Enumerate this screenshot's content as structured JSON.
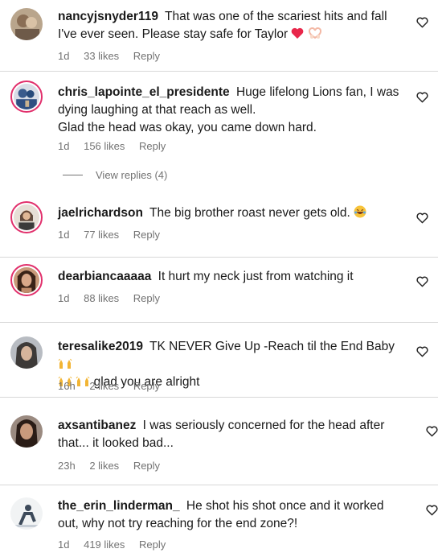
{
  "comments": [
    {
      "username": "nancyjsnyder119",
      "text": "That was one of the scariest hits and fall I've ever seen. Please stay safe for Taylor",
      "time": "1d",
      "likes": "33 likes",
      "reply": "Reply",
      "emojis": [
        "red-heart-icon",
        "heart-hands-icon"
      ]
    },
    {
      "username": "chris_lapointe_el_presidente",
      "text": "Huge lifelong Lions fan, I was dying laughing at that reach as well.",
      "text2": "Glad the head was okay, you came down hard.",
      "time": "1d",
      "likes": "156 likes",
      "reply": "Reply",
      "view_replies": "View replies (4)"
    },
    {
      "username": "jaelrichardson",
      "text": "The big brother roast never gets old.",
      "time": "1d",
      "likes": "77 likes",
      "reply": "Reply",
      "emojis": [
        "laughing-face-icon"
      ]
    },
    {
      "username": "dearbiancaaaaa",
      "text": "It hurt my neck just from watching it",
      "time": "1d",
      "likes": "88 likes",
      "reply": "Reply"
    },
    {
      "username": "teresalike2019",
      "text": "TK NEVER Give Up -Reach til the End Baby",
      "text_after": "glad you are alright",
      "time": "16h",
      "likes": "2 likes",
      "reply": "Reply",
      "emojis": [
        "raising-hands-icon"
      ]
    },
    {
      "username": "axsantibanez",
      "text": "I was seriously concerned for the head after that... it looked bad...",
      "time": "23h",
      "likes": "2 likes",
      "reply": "Reply"
    },
    {
      "username": "the_erin_linderman_",
      "text": "He shot his shot once and it worked out, why not try reaching for the end zone?!",
      "time": "1d",
      "likes": "419 likes",
      "reply": "Reply"
    }
  ],
  "colors": {
    "text": "#1a1a1a",
    "meta": "#737373",
    "story_ring": "#e1306c",
    "separator": "#d8d8d8",
    "heart_emoji": "#e8264a"
  },
  "icons": [
    "like-heart-outline-icon"
  ]
}
